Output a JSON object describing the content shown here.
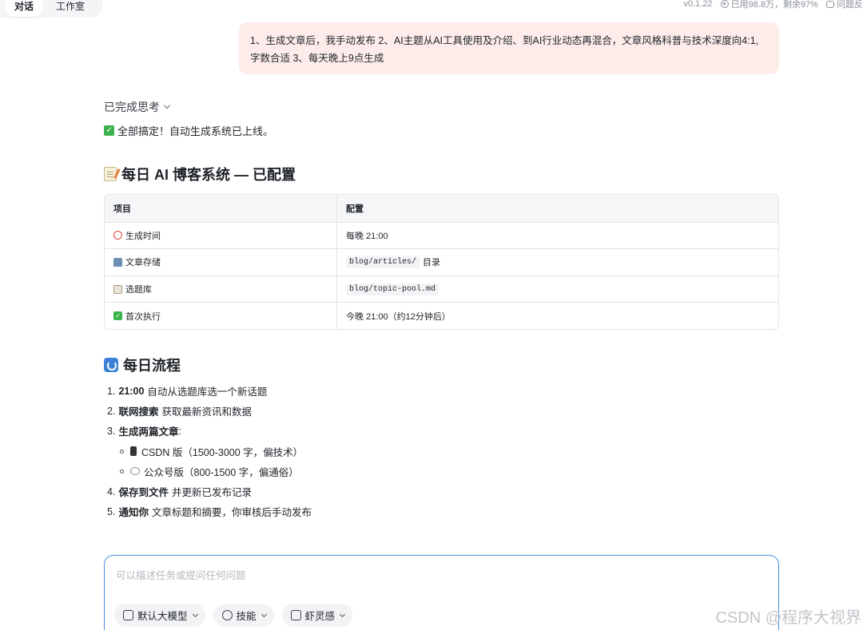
{
  "tabs": [
    {
      "label": "对话"
    },
    {
      "label": "工作室"
    }
  ],
  "top_right": {
    "version": "v0.1.22",
    "usage": "已用98.8万，剩余97%",
    "feedback": "问题反"
  },
  "user_message": {
    "line1": "1、生成文章后，我手动发布 2、AI主题从AI工具使用及介绍、到AI行业动态再混合，文章风格科普与技术深度向4:1,",
    "line2": "字数合适 3、每天晚上9点生成"
  },
  "thinking": {
    "label": "已完成思考"
  },
  "status": {
    "text": "全部搞定！自动生成系统已上线。"
  },
  "section1": {
    "title": "每日 AI 博客系统 — 已配置"
  },
  "table": {
    "headers": [
      "项目",
      "配置"
    ],
    "rows": [
      {
        "item": "生成时间",
        "value_text": "每晚 21:00",
        "code": "",
        "suffix": ""
      },
      {
        "item": "文章存储",
        "value_text": "",
        "code": "blog/articles/",
        "suffix": "目录"
      },
      {
        "item": "选题库",
        "value_text": "",
        "code": "blog/topic-pool.md",
        "suffix": ""
      },
      {
        "item": "首次执行",
        "value_text": "今晚 21:00（约12分钟后）",
        "code": "",
        "suffix": ""
      }
    ]
  },
  "section2": {
    "title": "每日流程"
  },
  "steps": [
    {
      "num": "1.",
      "bold": "21:00",
      "text": "自动从选题库选一个新话题"
    },
    {
      "num": "2.",
      "bold": "联网搜索",
      "text": "获取最新资讯和数据"
    },
    {
      "num": "3.",
      "bold": "生成两篇文章",
      "text": ":"
    },
    {
      "sub": true,
      "text": "CSDN 版（1500-3000 字，偏技术）"
    },
    {
      "sub": true,
      "text": "公众号版（800-1500 字，偏通俗）"
    },
    {
      "num": "4.",
      "bold": "保存到文件",
      "text": "并更新已发布记录"
    },
    {
      "num": "5.",
      "bold": "通知你",
      "text": "文章标题和摘要，你审核后手动发布"
    }
  ],
  "composer": {
    "placeholder": "可以描述任务或提问任何问题",
    "chips": [
      {
        "label": "默认大模型"
      },
      {
        "label": "技能"
      },
      {
        "label": "虾灵感"
      }
    ]
  },
  "watermark": "CSDN @程序大视界"
}
